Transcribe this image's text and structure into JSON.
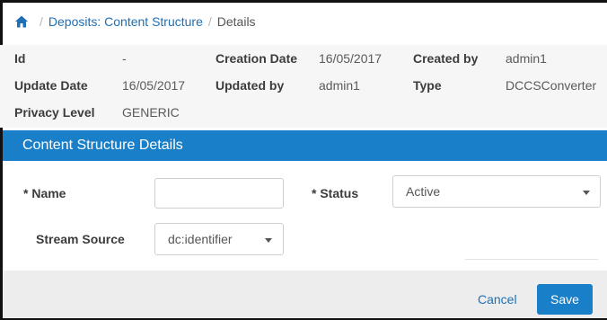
{
  "breadcrumb": {
    "home_icon": "home-icon",
    "items": [
      "Deposits: Content Structure",
      "Details"
    ]
  },
  "info": {
    "id_label": "Id",
    "id_value": "-",
    "creation_date_label": "Creation Date",
    "creation_date_value": "16/05/2017",
    "created_by_label": "Created by",
    "created_by_value": "admin1",
    "update_date_label": "Update Date",
    "update_date_value": "16/05/2017",
    "updated_by_label": "Updated by",
    "updated_by_value": "admin1",
    "type_label": "Type",
    "type_value": "DCCSConverter",
    "privacy_level_label": "Privacy Level",
    "privacy_level_value": "GENERIC"
  },
  "section": {
    "title": "Content Structure Details"
  },
  "form": {
    "name_label": "* Name",
    "name_value": "",
    "status_label": "* Status",
    "status_value": "Active",
    "stream_source_label": "Stream Source",
    "stream_source_value": "dc:identifier"
  },
  "footer": {
    "cancel_label": "Cancel",
    "save_label": "Save"
  },
  "colors": {
    "accent": "#1a7fc9",
    "link": "#1f6fb3"
  }
}
